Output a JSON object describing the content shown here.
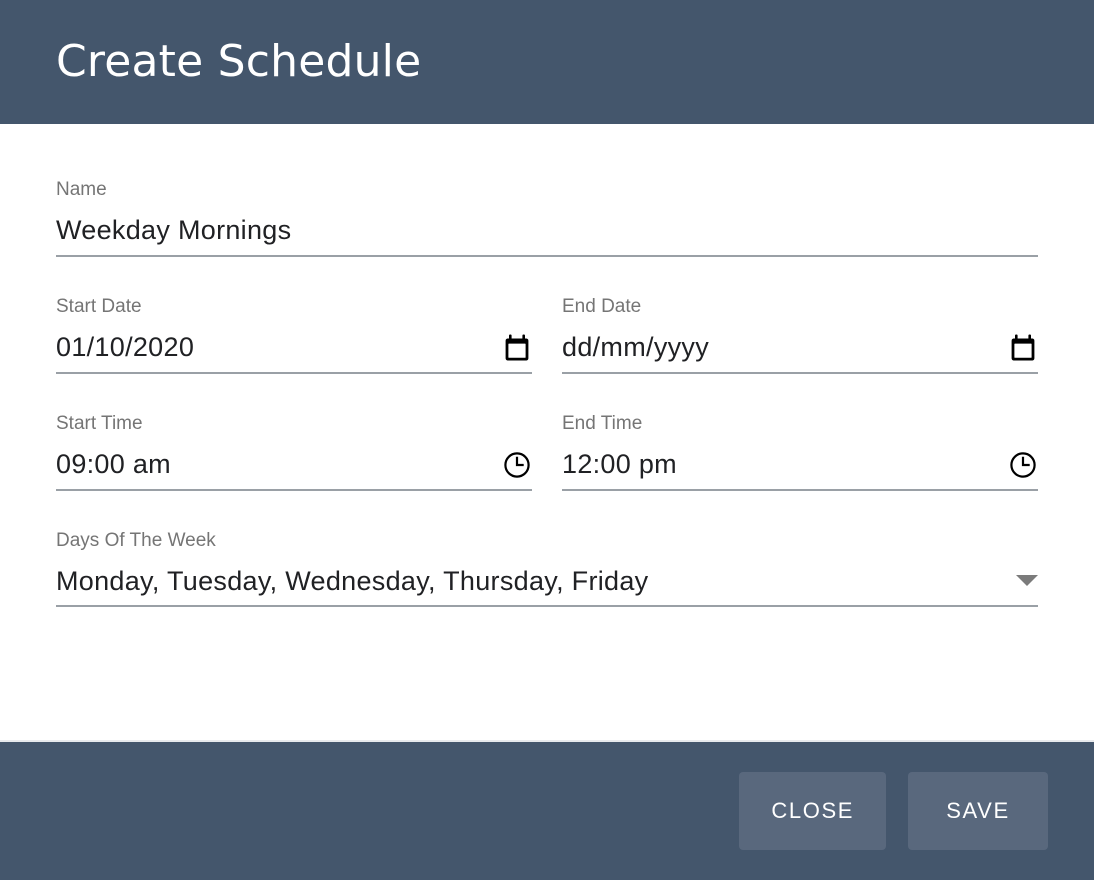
{
  "dialog": {
    "title": "Create Schedule",
    "accent_header_color": "#44566c",
    "accent_footer_color": "#44566c",
    "button_color": "#59687d"
  },
  "form": {
    "name": {
      "label": "Name",
      "value": "Weekday Mornings"
    },
    "start_date": {
      "label": "Start Date",
      "value": "01/10/2020",
      "placeholder": "dd/mm/yyyy",
      "icon": "calendar-icon"
    },
    "end_date": {
      "label": "End Date",
      "value": "dd/mm/yyyy",
      "placeholder": "dd/mm/yyyy",
      "icon": "calendar-icon"
    },
    "start_time": {
      "label": "Start Time",
      "value": "09:00 am",
      "icon": "clock-icon"
    },
    "end_time": {
      "label": "End Time",
      "value": "12:00 pm",
      "icon": "clock-icon"
    },
    "days_of_week": {
      "label": "Days Of The Week",
      "value": "Monday, Tuesday, Wednesday, Thursday, Friday",
      "icon": "chevron-down-icon"
    }
  },
  "footer": {
    "close_label": "CLOSE",
    "save_label": "SAVE"
  }
}
